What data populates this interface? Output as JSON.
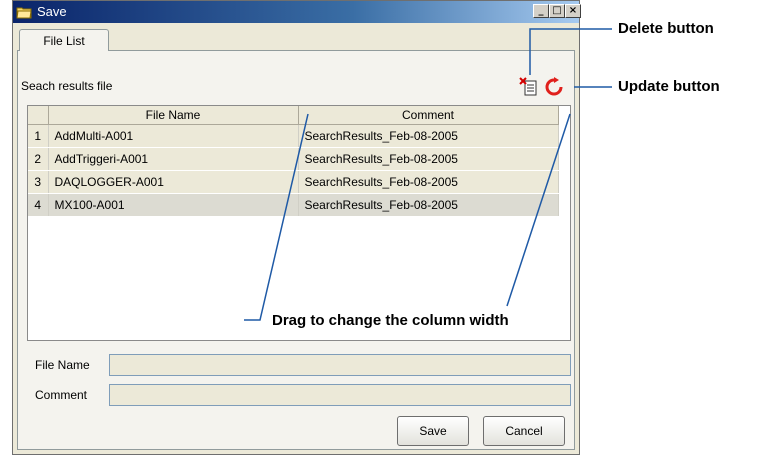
{
  "window": {
    "title": "Save"
  },
  "tabs": [
    {
      "label": "File List"
    }
  ],
  "panel": {
    "label": "Seach results file"
  },
  "table": {
    "columns": [
      "File Name",
      "Comment"
    ],
    "rows": [
      {
        "num": "1",
        "file": "AddMulti-A001",
        "comment": "SearchResults_Feb-08-2005"
      },
      {
        "num": "2",
        "file": "AddTriggeri-A001",
        "comment": "SearchResults_Feb-08-2005"
      },
      {
        "num": "3",
        "file": "DAQLOGGER-A001",
        "comment": "SearchResults_Feb-08-2005"
      },
      {
        "num": "4",
        "file": "MX100-A001",
        "comment": "SearchResults_Feb-08-2005"
      }
    ]
  },
  "fields": {
    "file_name_label": "File Name",
    "file_name_value": "",
    "comment_label": "Comment",
    "comment_value": ""
  },
  "buttons": {
    "save": "Save",
    "cancel": "Cancel"
  },
  "callouts": {
    "delete": "Delete button",
    "update": "Update button",
    "drag": "Drag to change the column width"
  },
  "colors": {
    "title_start": "#0a246a",
    "update_icon": "#e0201c",
    "callout_line": "#1f5aa6"
  }
}
